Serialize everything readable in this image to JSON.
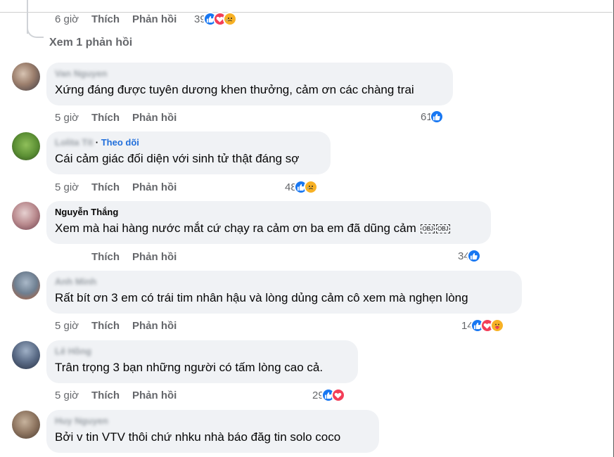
{
  "previous_comment": {
    "time": "6 giờ",
    "like_label": "Thích",
    "reply_label": "Phản hồi",
    "reaction_count": "39",
    "view_replies": "Xem 1 phản hồi"
  },
  "comments": [
    {
      "author": "Van Nguyen",
      "author_suffix": "",
      "follow": "",
      "text": "Xứng đáng được tuyên dương khen thưởng, cảm ơn các chàng trai",
      "time": "5 giờ",
      "like_label": "Thích",
      "reply_label": "Phản hồi",
      "reaction_count": "61",
      "reactions": [
        "like"
      ]
    },
    {
      "author": "Lolita Tít",
      "author_suffix": " · ",
      "follow": "Theo dõi",
      "text": "Cái cảm giác đối diện với sinh tử thật đáng sợ",
      "time": "5 giờ",
      "like_label": "Thích",
      "reply_label": "Phản hồi",
      "reaction_count": "48",
      "reactions": [
        "like",
        "sad"
      ]
    },
    {
      "author": "Nguyễn Thắng",
      "author_suffix": "",
      "follow": "",
      "text": "Xem mà hai hàng nước mắt cứ chạy ra cảm ơn ba em đã dũng cảm",
      "emoji_placeholders": [
        "OBJ",
        "OBJ"
      ],
      "time": "",
      "like_label": "Thích",
      "reply_label": "Phản hồi",
      "reaction_count": "34",
      "reactions": [
        "like"
      ]
    },
    {
      "author": "Anh Minh",
      "author_suffix": "",
      "follow": "",
      "text": "Rất bít ơn 3 em có trái tim nhân hậu và lòng dủng cảm cô xem mà nghẹn lòng",
      "time": "5 giờ",
      "like_label": "Thích",
      "reply_label": "Phản hồi",
      "reaction_count": "14",
      "reactions": [
        "like",
        "love",
        "care"
      ]
    },
    {
      "author": "Lê Hồng",
      "author_suffix": "",
      "follow": "",
      "text": "Trân trọng 3 bạn những người có tấm lòng cao cả.",
      "time": "5 giờ",
      "like_label": "Thích",
      "reply_label": "Phản hồi",
      "reaction_count": "29",
      "reactions": [
        "like",
        "love"
      ]
    },
    {
      "author": "Huy Nguyen",
      "author_suffix": "",
      "follow": "",
      "text": "Bởi v tin VTV thôi chứ nhku nhà báo đăg tin solo coco",
      "time": "",
      "like_label": "",
      "reply_label": "",
      "reaction_count": "",
      "reactions": []
    }
  ],
  "colors": {
    "like": "#1877f2",
    "love": "#f33e58",
    "haha": "#f7b125",
    "bubble": "#f0f2f5",
    "meta": "#65676b",
    "follow": "#216fdb"
  }
}
